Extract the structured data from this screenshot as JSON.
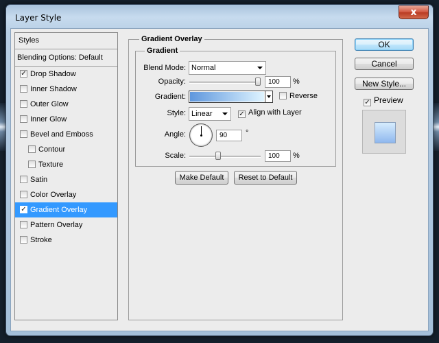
{
  "window": {
    "title": "Layer Style",
    "close_glyph": "x"
  },
  "styles_panel": {
    "header": "Styles",
    "blending_options": "Blending Options: Default",
    "items": [
      {
        "label": "Drop Shadow",
        "checked": true,
        "selected": false,
        "sub": false
      },
      {
        "label": "Inner Shadow",
        "checked": false,
        "selected": false,
        "sub": false
      },
      {
        "label": "Outer Glow",
        "checked": false,
        "selected": false,
        "sub": false
      },
      {
        "label": "Inner Glow",
        "checked": false,
        "selected": false,
        "sub": false
      },
      {
        "label": "Bevel and Emboss",
        "checked": false,
        "selected": false,
        "sub": false
      },
      {
        "label": "Contour",
        "checked": false,
        "selected": false,
        "sub": true
      },
      {
        "label": "Texture",
        "checked": false,
        "selected": false,
        "sub": true
      },
      {
        "label": "Satin",
        "checked": false,
        "selected": false,
        "sub": false
      },
      {
        "label": "Color Overlay",
        "checked": false,
        "selected": false,
        "sub": false
      },
      {
        "label": "Gradient Overlay",
        "checked": true,
        "selected": true,
        "sub": false
      },
      {
        "label": "Pattern Overlay",
        "checked": false,
        "selected": false,
        "sub": false
      },
      {
        "label": "Stroke",
        "checked": false,
        "selected": false,
        "sub": false
      }
    ]
  },
  "gradient_overlay": {
    "section_title": "Gradient Overlay",
    "group_title": "Gradient",
    "blend_mode_label": "Blend Mode:",
    "blend_mode_value": "Normal",
    "opacity_label": "Opacity:",
    "opacity_value": "100",
    "opacity_fraction": 1.0,
    "percent": "%",
    "gradient_label": "Gradient:",
    "gradient_colors": [
      "#5f97dd",
      "#dff4ff"
    ],
    "reverse_label": "Reverse",
    "reverse_checked": false,
    "style_label": "Style:",
    "style_value": "Linear",
    "align_label": "Align with Layer",
    "align_checked": true,
    "angle_label": "Angle:",
    "angle_value": "90",
    "degree": "°",
    "scale_label": "Scale:",
    "scale_value": "100",
    "scale_fraction": 0.5
  },
  "bottom_buttons": {
    "make_default": "Make Default",
    "reset_default": "Reset to Default"
  },
  "side_buttons": {
    "ok": "OK",
    "cancel": "Cancel",
    "new_style": "New Style...",
    "preview_label": "Preview",
    "preview_checked": true
  },
  "colors": {
    "selection": "#3399ff",
    "ok_border": "#3c7fb1"
  }
}
